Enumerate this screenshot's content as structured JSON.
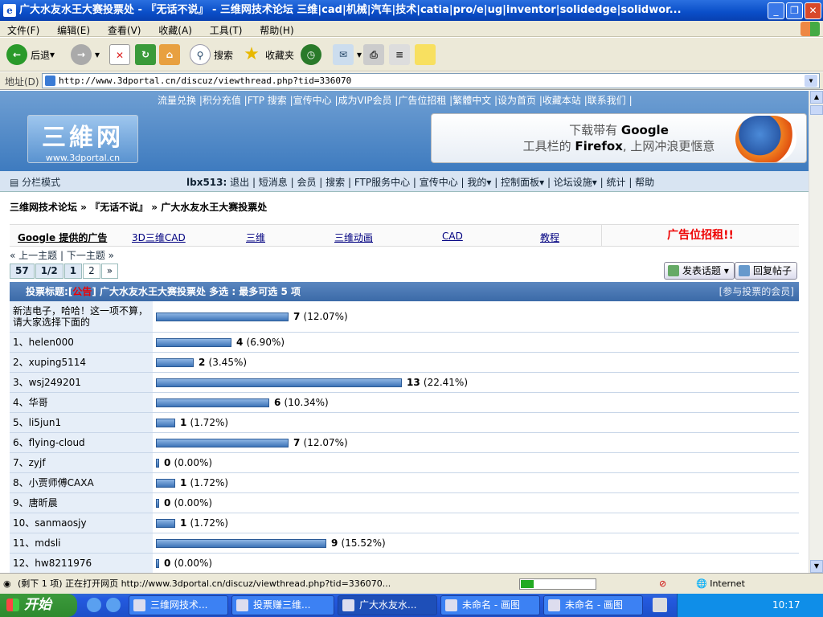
{
  "window": {
    "title": "广大水友水王大赛投票处 - 『无话不说』 - 三维网技术论坛 三维|cad|机械|汽车|技术|catia|pro/e|ug|inventor|solidedge|solidwor..."
  },
  "menu": [
    "文件(F)",
    "编辑(E)",
    "查看(V)",
    "收藏(A)",
    "工具(T)",
    "帮助(H)"
  ],
  "toolbar": {
    "back": "后退",
    "search": "搜索",
    "favorites": "收藏夹"
  },
  "address": {
    "label": "地址(D)",
    "url": "http://www.3dportal.cn/discuz/viewthread.php?tid=336070"
  },
  "site": {
    "toplinks": "流量兑换 |积分充值 |FTP 搜索 |宣传中心 |成为VIP会员 |广告位招租 |繁體中文 |设为首页 |收藏本站 |联系我们 |",
    "logo_text": "三維网",
    "logo_url": "www.3dportal.cn",
    "banner_line1_a": "下载带有 ",
    "banner_line1_b": "Google",
    "banner_line2_a": "工具栏的 ",
    "banner_line2_b": "Firefox",
    "banner_line2_c": ", 上网冲浪更惬意"
  },
  "nav": {
    "mode": "分栏模式",
    "user": "lbx513:",
    "links": "退出 | 短消息 | 会员 | 搜索 | FTP服务中心 | 宣传中心 | 我的▾ | 控制面板▾ | 论坛设施▾ | 统计 | 帮助"
  },
  "breadcrumb": "三维网技术论坛 » 『无话不说』 » 广大水友水王大赛投票处",
  "ads": {
    "google": "Google 提供的广告",
    "a1": "3D三维CAD",
    "a2": "三维",
    "a3": "三维动画",
    "a4": "CAD",
    "a5": "教程",
    "rent": "广告位招租!!"
  },
  "prev_next": "« 上一主题 | 下一主题 »",
  "pager": {
    "total": "57",
    "pages": "1/2",
    "p1": "1",
    "p2": "2",
    "next": "»"
  },
  "buttons": {
    "new_topic": "发表话题",
    "reply": "回复帖子"
  },
  "poll": {
    "label": "投票标题:",
    "tag_open": "[",
    "tag": "公告",
    "tag_close": "]",
    "title": " 广大水友水王大赛投票处 多选 : 最多可选 5 项",
    "voters": "[参与投票的会员]",
    "options": [
      {
        "label": "新洁电子，哈哈！这一项不算，请大家选择下面的",
        "votes": "7",
        "pct": "(12.07%)",
        "value": 7
      },
      {
        "label": "1、helen000",
        "votes": "4",
        "pct": "(6.90%)",
        "value": 4
      },
      {
        "label": "2、xuping5114",
        "votes": "2",
        "pct": "(3.45%)",
        "value": 2
      },
      {
        "label": "3、wsj249201",
        "votes": "13",
        "pct": "(22.41%)",
        "value": 13
      },
      {
        "label": "4、华哥",
        "votes": "6",
        "pct": "(10.34%)",
        "value": 6
      },
      {
        "label": "5、li5jun1",
        "votes": "1",
        "pct": "(1.72%)",
        "value": 1
      },
      {
        "label": "6、flying-cloud",
        "votes": "7",
        "pct": "(12.07%)",
        "value": 7
      },
      {
        "label": "7、zyjf",
        "votes": "0",
        "pct": "(0.00%)",
        "value": 0
      },
      {
        "label": "8、小贾师傅CAXA",
        "votes": "1",
        "pct": "(1.72%)",
        "value": 1
      },
      {
        "label": "9、唐昕晨",
        "votes": "0",
        "pct": "(0.00%)",
        "value": 0
      },
      {
        "label": "10、sanmaosjy",
        "votes": "1",
        "pct": "(1.72%)",
        "value": 1
      },
      {
        "label": "11、mdsli",
        "votes": "9",
        "pct": "(15.52%)",
        "value": 9
      },
      {
        "label": "12、hw8211976",
        "votes": "0",
        "pct": "(0.00%)",
        "value": 0
      }
    ]
  },
  "status": {
    "text": "(剩下 1 项) 正在打开网页 http://www.3dportal.cn/discuz/viewthread.php?tid=336070...",
    "zone": "Internet"
  },
  "taskbar": {
    "start": "开始",
    "t1": "三维网技术...",
    "t2": "投票赚三维...",
    "t3": "广大水友水...",
    "t4": "未命名 - 画图",
    "t5": "未命名 - 画图",
    "clock": "10:17"
  }
}
